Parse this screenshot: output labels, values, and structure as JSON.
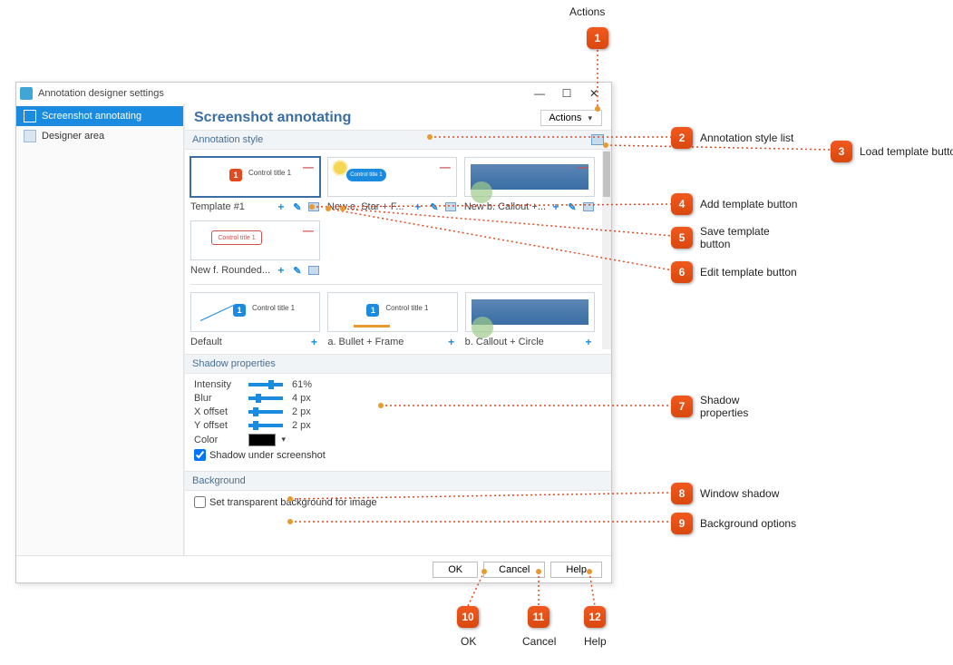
{
  "window": {
    "title": "Annotation designer settings",
    "actions_label": "Actions"
  },
  "sidebar": {
    "items": [
      {
        "label": "Screenshot annotating",
        "selected": true
      },
      {
        "label": "Designer area",
        "selected": false
      }
    ]
  },
  "page": {
    "title": "Screenshot annotating"
  },
  "sections": {
    "annotation_style": "Annotation style",
    "shadow_properties": "Shadow properties",
    "background": "Background"
  },
  "templates_top": [
    {
      "name": "Template #1",
      "selected": true,
      "thumb_caption": "Control title 1"
    },
    {
      "name": "New e. Star + F...",
      "thumb_caption": "Control title 1"
    },
    {
      "name": "New b. Callout +..."
    },
    {
      "name": "New f. Rounded...",
      "thumb_caption": "Control title 1"
    }
  ],
  "templates_bottom": [
    {
      "name": "Default",
      "thumb_caption": "Control title 1"
    },
    {
      "name": "a. Bullet + Frame",
      "thumb_caption": "Control title 1"
    },
    {
      "name": "b. Callout + Circle"
    }
  ],
  "shadow": {
    "intensity_label": "Intensity",
    "intensity_value": "61%",
    "blur_label": "Blur",
    "blur_value": "4 px",
    "xoffset_label": "X offset",
    "xoffset_value": "2 px",
    "yoffset_label": "Y offset",
    "yoffset_value": "2 px",
    "color_label": "Color",
    "shadow_under_label": "Shadow under screenshot"
  },
  "background_opts": {
    "transparent_label": "Set transparent background for image"
  },
  "footer": {
    "ok": "OK",
    "cancel": "Cancel",
    "help": "Help"
  },
  "callouts": {
    "c1": {
      "n": "1",
      "label": "Actions"
    },
    "c2": {
      "n": "2",
      "label": "Annotation style list"
    },
    "c3": {
      "n": "3",
      "label": "Load template button"
    },
    "c4": {
      "n": "4",
      "label": "Add template button"
    },
    "c5": {
      "n": "5",
      "label": "Save template button"
    },
    "c6": {
      "n": "6",
      "label": "Edit template button"
    },
    "c7": {
      "n": "7",
      "label": "Shadow properties"
    },
    "c8": {
      "n": "8",
      "label": "Window shadow"
    },
    "c9": {
      "n": "9",
      "label": "Background options"
    },
    "c10": {
      "n": "10",
      "label": "OK"
    },
    "c11": {
      "n": "11",
      "label": "Cancel"
    },
    "c12": {
      "n": "12",
      "label": "Help"
    }
  }
}
